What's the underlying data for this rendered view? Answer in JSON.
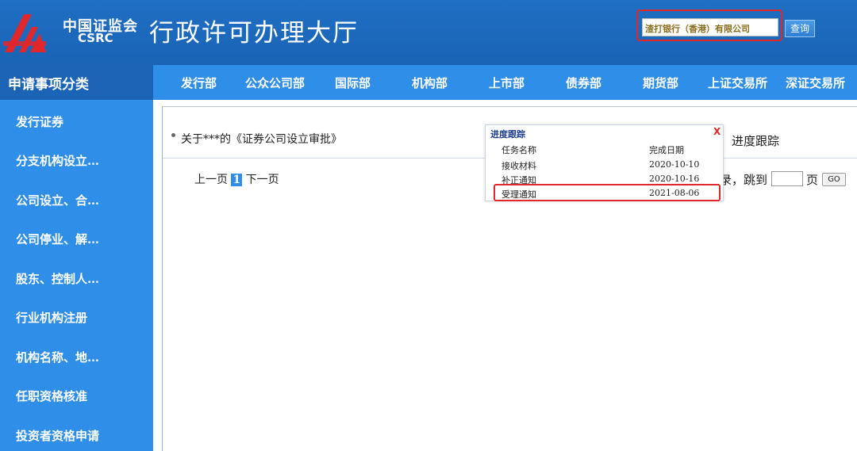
{
  "header": {
    "logo_cn": "中国证监会",
    "logo_en": "CSRC",
    "site_title": "行政许可办理大厅",
    "search_value": "渣打银行（香港）有限公司",
    "search_button": "查询"
  },
  "nav": {
    "category_head": "申请事项分类",
    "items": [
      "发行部",
      "公众公司部",
      "国际部",
      "机构部",
      "上市部",
      "债券部",
      "期货部",
      "上证交易所",
      "深证交易所"
    ]
  },
  "sidebar": {
    "items": [
      "发行证券",
      "分支机构设立…",
      "公司设立、合…",
      "公司停业、解…",
      "股东、控制人…",
      "行业机构注册",
      "机构名称、地…",
      "任职资格核准",
      "投资者资格申请"
    ]
  },
  "main": {
    "item_title": "关于***的《证券公司设立审批》",
    "track_link": "进度跟踪",
    "pager": {
      "prev": "上一页",
      "current": "1",
      "next": "下一页",
      "jump_text": "录，跳到",
      "page_label": "页",
      "go": "GO"
    }
  },
  "popup": {
    "title": "进度跟踪",
    "close": "X",
    "header": {
      "name": "任务名称",
      "date": "完成日期"
    },
    "rows": [
      {
        "name": "接收材料",
        "date": "2020-10-10"
      },
      {
        "name": "补正通知",
        "date": "2020-10-16"
      },
      {
        "name": "受理通知",
        "date": "2021-08-06"
      }
    ]
  },
  "colors": {
    "header_blue": "#1a63b5",
    "nav_blue": "#2f8ee8",
    "highlight_red": "#e0272b"
  }
}
